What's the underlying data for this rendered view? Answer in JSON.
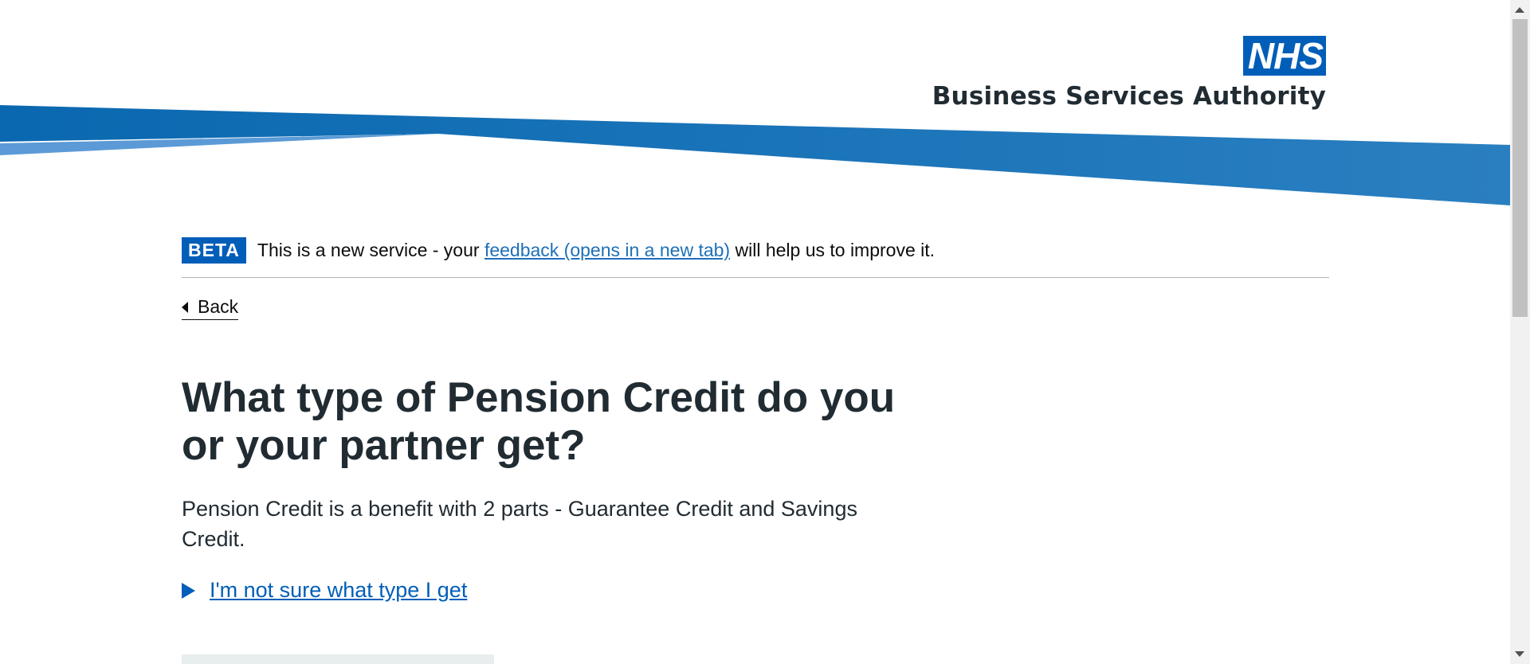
{
  "header": {
    "logo_mark": "NHS",
    "org_name": "Business Services Authority"
  },
  "phase_banner": {
    "tag": "BETA",
    "text_before": "This is a new service - your",
    "link_text": "feedback (opens in a new tab)",
    "text_after": "will help us to improve it."
  },
  "back_link": {
    "label": "Back"
  },
  "page": {
    "heading": "What type of Pension Credit do you or your partner get?",
    "lede": "Pension Credit is a benefit with 2 parts - Guarantee Credit and Savings Credit.",
    "details_summary": "I'm not sure what type I get"
  },
  "colors": {
    "nhs_blue": "#005eb8",
    "link_blue": "#1d70b8",
    "text": "#212b32"
  }
}
